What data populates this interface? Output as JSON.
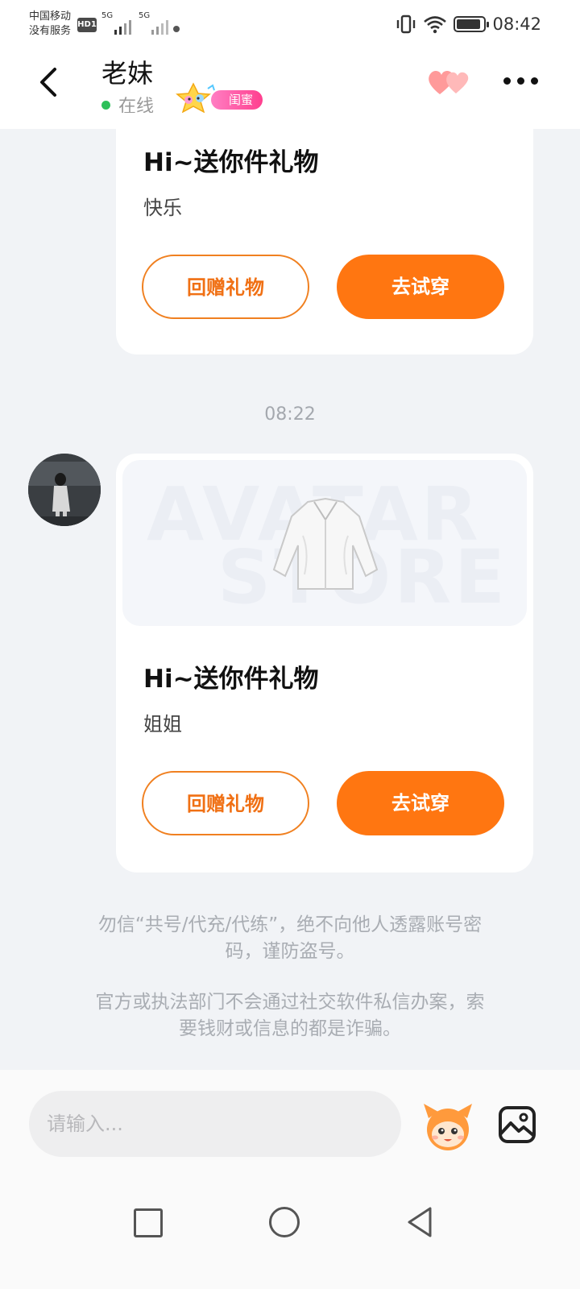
{
  "status_bar": {
    "carrier_line1": "中国移动",
    "carrier_line2": "没有服务",
    "hd_badge": "HD1",
    "net1": "5G",
    "net2": "5G",
    "time": "08:42",
    "battery_level": 0.9
  },
  "header": {
    "title": "老妹",
    "status": "在线",
    "relation_tag": "闺蜜",
    "icons": [
      "back-arrow-icon",
      "hearts-icon",
      "more-icon"
    ]
  },
  "messages": [
    {
      "title": "Hi~送你件礼物",
      "text": "快乐",
      "return_gift_label": "回赠礼物",
      "try_on_label": "去试穿"
    },
    {
      "time": "08:22",
      "watermark_line1": "AVATAR",
      "watermark_line2": "STORE",
      "title": "Hi~送你件礼物",
      "text": "姐姐",
      "return_gift_label": "回赠礼物",
      "try_on_label": "去试穿"
    }
  ],
  "notices": {
    "line1a": "勿信“共号/代充/代练”，绝不向他人透露账号密",
    "line1b": "码，谨防盗号。",
    "line2a": "官方或执法部门不会通过社交软件私信办案，索",
    "line2b": "要钱财或信息的都是诈骗。"
  },
  "input": {
    "placeholder": "请输入..."
  },
  "colors": {
    "accent": "#ff7611",
    "background": "#f1f3f6",
    "online": "#2ec05a"
  }
}
